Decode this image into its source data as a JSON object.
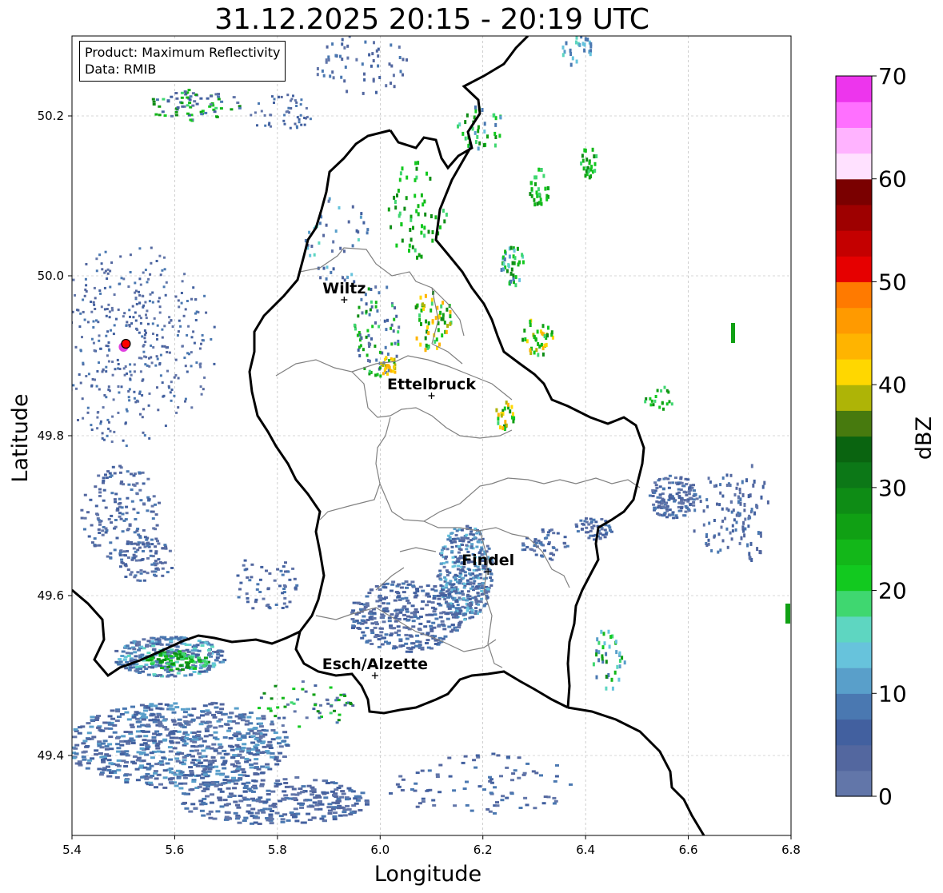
{
  "title": "31.12.2025 20:15 - 20:19 UTC",
  "info_box": {
    "product": "Product: Maximum Reflectivity",
    "source": "Data: RMIB"
  },
  "axes": {
    "xlabel": "Longitude",
    "ylabel": "Latitude",
    "xlim": [
      5.4,
      6.8
    ],
    "ylim": [
      49.3,
      50.3
    ],
    "xticks": [
      5.4,
      5.6,
      5.8,
      6.0,
      6.2,
      6.4,
      6.6,
      6.8
    ],
    "xtick_labels": [
      "5.4",
      "5.6",
      "5.8",
      "6.0",
      "6.2",
      "6.4",
      "6.6",
      "6.8"
    ],
    "yticks": [
      49.4,
      49.6,
      49.8,
      50.0,
      50.2
    ],
    "ytick_labels": [
      "49.4",
      "49.6",
      "49.8",
      "50.0",
      "50.2"
    ],
    "grid": true
  },
  "colorbar": {
    "label": "dBZ",
    "min": 0,
    "max": 70,
    "ticks": [
      "0",
      "10",
      "20",
      "30",
      "40",
      "50",
      "60",
      "70"
    ],
    "colors": [
      "#6276a9",
      "#53679f",
      "#42609f",
      "#4a78b1",
      "#599fca",
      "#67c3dc",
      "#5ed6c1",
      "#3fd770",
      "#12c91f",
      "#13b719",
      "#10a014",
      "#0e8c15",
      "#0c7817",
      "#0a6410",
      "#477a0e",
      "#aeb406",
      "#ffd700",
      "#ffb400",
      "#ff9a00",
      "#ff7a00",
      "#e60000",
      "#c40000",
      "#9e0000",
      "#7a0000",
      "#ffe1ff",
      "#ffb3ff",
      "#ff70ff",
      "#ed35ed"
    ]
  },
  "cities": [
    {
      "name": "Wiltz",
      "lon": 5.93,
      "lat": 49.97
    },
    {
      "name": "Ettelbruck",
      "lon": 6.1,
      "lat": 49.85
    },
    {
      "name": "Findel",
      "lon": 6.21,
      "lat": 49.63
    },
    {
      "name": "Esch/Alzette",
      "lon": 5.99,
      "lat": 49.5
    }
  ],
  "radar_site": {
    "lon": 5.505,
    "lat": 49.915,
    "color": "#ff0000"
  },
  "map_colors": {
    "country_border": "#000000",
    "canton_border": "#808080",
    "grid": "#b0b0b0"
  }
}
